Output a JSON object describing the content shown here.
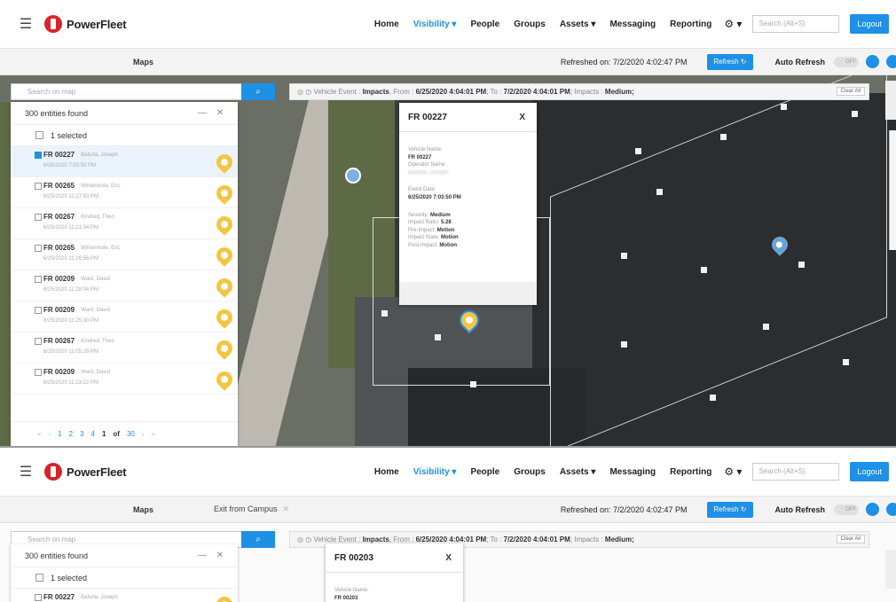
{
  "nav": {
    "brand": "PowerFleet",
    "links": [
      "Home",
      "Visibility",
      "People",
      "Groups",
      "Assets",
      "Messaging",
      "Reporting"
    ],
    "active_index": 1,
    "search_placeholder": "Search (Alt+S)",
    "logout_label": "Logout",
    "accent_color": "#1e90e6",
    "brand_color": "#d8232a"
  },
  "top": {
    "subbar": {
      "tab_maps": "Maps",
      "refreshed": "Refreshed on: 7/2/2020 4:02:47 PM",
      "refresh_label": "Refresh",
      "auto_refresh_label": "Auto Refresh",
      "toggle_label": "OFF"
    },
    "map": {
      "search_placeholder": "Search on map",
      "filter": {
        "prefix": "Vehicle Event : ",
        "impacts": "Impacts",
        "from_label": ", From : ",
        "from": "6/25/2020 4:04:01 PM",
        "to_label": "; To : ",
        "to": "7/2/2020 4:04:01 PM",
        "impacts_label": "; Impacts : ",
        "level": "Medium;"
      },
      "clear_all": "Clear All"
    },
    "panel": {
      "count": "300 entities found",
      "controls": "— ✕",
      "selected": "1 selected",
      "entities": [
        {
          "name": "FR 00227",
          "operator": "Baturla, Joseph",
          "date": "6/25/2020 7:03:50 PM",
          "checked": true
        },
        {
          "name": "FR 00265",
          "operator": "Wintermute, Eric",
          "date": "6/25/2020 11:27:43 PM",
          "checked": false
        },
        {
          "name": "FR 00267",
          "operator": "Kindred, Theo",
          "date": "6/25/2020 11:21:04 PM",
          "checked": false
        },
        {
          "name": "FR 00265",
          "operator": "Wintermute, Eric",
          "date": "6/25/2020 11:26:56 PM",
          "checked": false
        },
        {
          "name": "FR 00209",
          "operator": "Ward, David",
          "date": "6/25/2020 11:28:04 PM",
          "checked": false
        },
        {
          "name": "FR 00209",
          "operator": "Ward, David",
          "date": "6/25/2020 11:25:30 PM",
          "checked": false
        },
        {
          "name": "FR 00267",
          "operator": "Kindred, Theo",
          "date": "6/25/2020 11:05:28 PM",
          "checked": false
        },
        {
          "name": "FR 00209",
          "operator": "Ward, David",
          "date": "6/25/2020 11:23:22 PM",
          "checked": false
        }
      ],
      "pager": {
        "first": "«",
        "prev": "‹",
        "pages": [
          "1",
          "2",
          "3",
          "4"
        ],
        "current": "1",
        "of": "of",
        "total": "30",
        "next": "›",
        "last": "»"
      }
    },
    "popup": {
      "title": "FR 00227",
      "close": "X",
      "vehicle_name_label": "Vehicle Name:",
      "vehicle_name": "FR 00227",
      "operator_label": "Operator Name:",
      "operator": "Baturla, Joseph",
      "event_date_label": "Event Date:",
      "event_date": "6/25/2020 7:03:50 PM",
      "severity_label": "Severity:",
      "severity": "Medium",
      "impact_ratio_label": "Impact Ratio:",
      "impact_ratio": "5.28",
      "pre_impact_label": "Pre-Impact:",
      "pre_impact": "Motion",
      "impact_state_label": "Impact State:",
      "impact_state": "Motion",
      "post_impact_label": "Post-Impact:",
      "post_impact": "Motion"
    }
  },
  "bottom": {
    "subbar": {
      "tab_maps": "Maps",
      "tab_exit": "Exit from Campus",
      "refreshed": "Refreshed on: 7/2/2020 4:02:47 PM",
      "refresh_label": "Refresh",
      "auto_refresh_label": "Auto Refresh",
      "toggle_label": "OFF"
    },
    "map": {
      "search_placeholder": "Search on map",
      "filter": {
        "prefix": "Vehicle Event : ",
        "impacts": "Impacts",
        "from_label": ", From : ",
        "from": "6/25/2020 4:04:01 PM",
        "to_label": "; To : ",
        "to": "7/2/2020 4:04:01 PM",
        "impacts_label": "; Impacts : ",
        "level": "Medium;"
      },
      "clear_all": "Clear All"
    },
    "panel": {
      "count": "300 entities found",
      "controls": "— ✕",
      "selected": "1 selected",
      "first_entity": {
        "name": "FR 00227",
        "operator": "Baturla, Joseph"
      }
    },
    "popup": {
      "title": "FR 00203",
      "close": "X",
      "vehicle_name_label": "Vehicle Name:",
      "vehicle_name": "FR 00203"
    }
  }
}
